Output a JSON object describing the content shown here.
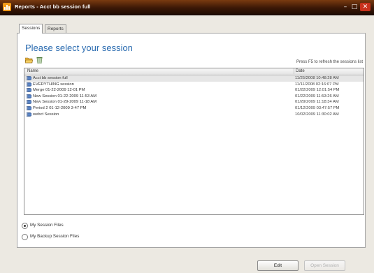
{
  "window": {
    "title": "Reports - Acct bb session full",
    "controls": {
      "minimize": "–",
      "maximize": "□",
      "close": "✕"
    }
  },
  "tabs": [
    {
      "label": "Sessions",
      "active": true
    },
    {
      "label": "Reports",
      "active": false
    }
  ],
  "panel": {
    "heading": "Please select your session",
    "toolbar_icons": [
      "folder-open-icon",
      "recycle-bin-icon"
    ],
    "refresh_hint": "Press F5 to refresh the sessions list"
  },
  "list": {
    "columns": {
      "name": "Name",
      "date": "Date"
    },
    "rows": [
      {
        "name": "Acct bb session full",
        "date": "11/25/2008 10:48:28 AM",
        "selected": true
      },
      {
        "name": "EVERYTHING session",
        "date": "11/11/2008 02:16:07 PM",
        "selected": false
      },
      {
        "name": "Merge 01-22-2009 12-01 PM",
        "date": "01/22/2009 12:01:54 PM",
        "selected": false
      },
      {
        "name": "New Session 01-22-2009 11-53 AM",
        "date": "01/22/2009 11:53:26 AM",
        "selected": false
      },
      {
        "name": "New Session 01-29-2009 11-18 AM",
        "date": "01/29/2009 11:18:34 AM",
        "selected": false
      },
      {
        "name": "Period 2 01-12-2009 3-47 PM",
        "date": "01/12/2009 03:47:57 PM",
        "selected": false
      },
      {
        "name": "webct Session",
        "date": "10/02/2009 11:30:02 AM",
        "selected": false
      }
    ]
  },
  "session_source": {
    "options": [
      {
        "label": "My Session Files",
        "checked": true
      },
      {
        "label": "My Backup Session Files",
        "checked": false
      }
    ]
  },
  "buttons": {
    "edit": "Edit",
    "open": "Open Session"
  },
  "colors": {
    "title_bar": "#3a1706",
    "heading": "#2a6bb0",
    "close_button": "#c8321c"
  }
}
